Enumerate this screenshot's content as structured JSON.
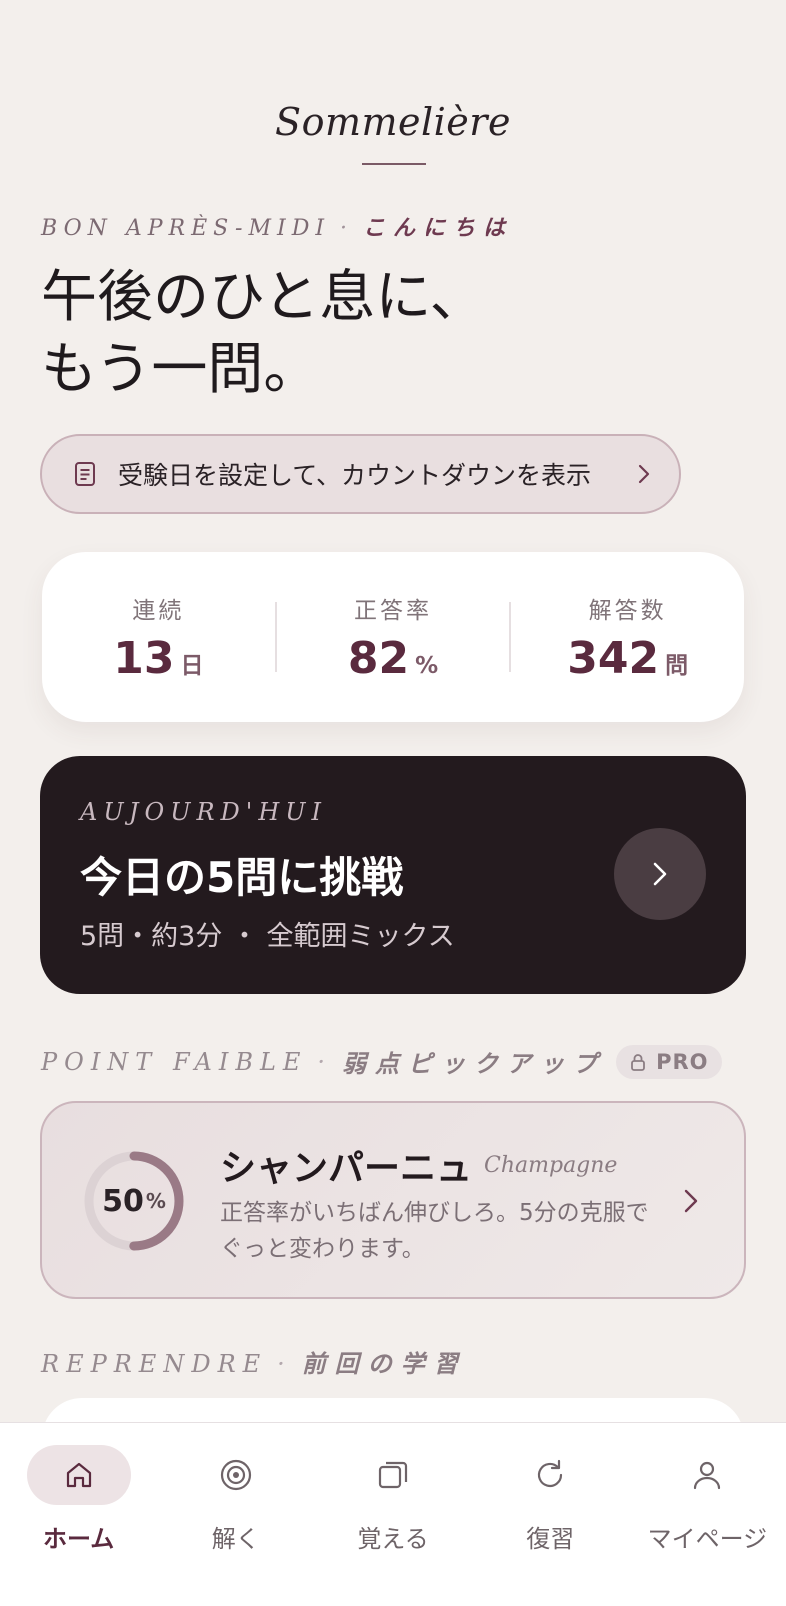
{
  "brand": {
    "name": "Sommelière"
  },
  "greeting": {
    "fr": "BON APRÈS-MIDI",
    "separator": "·",
    "jp": "こんにちは"
  },
  "headline": {
    "line1": "午後のひと息に、",
    "line2": "もう一問。"
  },
  "exam_prompt": {
    "label": "受験日を設定して、カウントダウンを表示",
    "icon": "document-icon"
  },
  "stats": [
    {
      "label": "連続",
      "value": "13",
      "unit": "日"
    },
    {
      "label": "正答率",
      "value": "82",
      "unit": "%"
    },
    {
      "label": "解答数",
      "value": "342",
      "unit": "問"
    }
  ],
  "today": {
    "eyebrow": "AUJOURD'HUI",
    "title": "今日の5問に挑戦",
    "subtitle": "5問・約3分 ・ 全範囲ミックス"
  },
  "weak_point": {
    "heading_fr": "POINT FAIBLE",
    "separator": "·",
    "heading_jp": "弱点ピックアップ",
    "badge": "PRO",
    "topic": "シャンパーニュ",
    "topic_fr": "Champagne",
    "percent": 50,
    "percent_text": "50",
    "percent_unit": "%",
    "description": "正答率がいちばん伸びしろ。5分の克服でぐっと変わります。"
  },
  "resume": {
    "heading_fr": "REPRENDRE",
    "separator": "·",
    "heading_jp": "前回の学習"
  },
  "colors": {
    "accent": "#5a2a3e",
    "dark_card": "#231a1e",
    "background": "#f3efec",
    "ring_progress": "#9a7a86"
  },
  "tabs": [
    {
      "label": "ホーム",
      "icon": "home-icon",
      "active": true
    },
    {
      "label": "解く",
      "icon": "target-icon",
      "active": false
    },
    {
      "label": "覚える",
      "icon": "cards-icon",
      "active": false
    },
    {
      "label": "復習",
      "icon": "refresh-icon",
      "active": false
    },
    {
      "label": "マイページ",
      "icon": "person-icon",
      "active": false
    }
  ]
}
